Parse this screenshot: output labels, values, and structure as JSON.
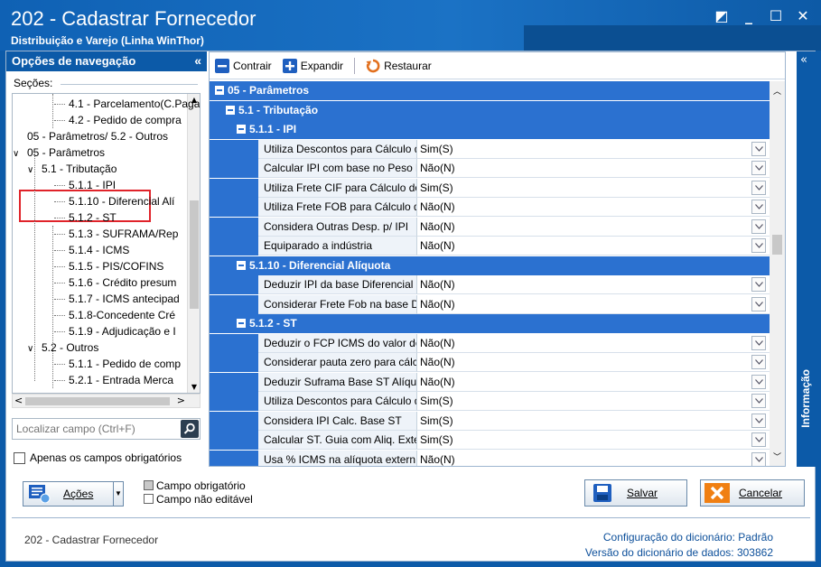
{
  "window": {
    "title": "202 - Cadastrar  Fornecedor",
    "subtitle": "Distribuição e Varejo (Linha WinThor)",
    "controls": [
      "◩",
      "_",
      "☐",
      "✕"
    ]
  },
  "nav": {
    "header": "Opções de navegação",
    "collapse": "«",
    "sections_label": "Seções:",
    "tree": [
      {
        "label": "4.1 - Parcelamento(C.Paga",
        "level": 2
      },
      {
        "label": "4.2 - Pedido de compra",
        "level": 2
      },
      {
        "label": "05 - Parâmetros/ 5.2 - Outros",
        "level": 0
      },
      {
        "label": "05 - Parâmetros",
        "level": 0,
        "expanded": true
      },
      {
        "label": "5.1 - Tributação",
        "level": 1,
        "expanded": true
      },
      {
        "label": "5.1.1 - IPI",
        "level": 2
      },
      {
        "label": "5.1.10 - Diferencial Alí",
        "level": 2
      },
      {
        "label": "5.1.2 - ST",
        "level": 2
      },
      {
        "label": "5.1.3 - SUFRAMA/Rep",
        "level": 2
      },
      {
        "label": "5.1.4 - ICMS",
        "level": 2
      },
      {
        "label": "5.1.5 - PIS/COFINS",
        "level": 2
      },
      {
        "label": "5.1.6 - Crédito presum",
        "level": 2
      },
      {
        "label": "5.1.7 - ICMS antecipad",
        "level": 2
      },
      {
        "label": "5.1.8-Concedente Cré",
        "level": 2
      },
      {
        "label": "5.1.9 - Adjudicação e I",
        "level": 2
      },
      {
        "label": "5.2 - Outros",
        "level": 1,
        "expanded": true
      },
      {
        "label": "5.1.1 - Pedido de comp",
        "level": 2
      },
      {
        "label": "5.2.1 - Entrada Merca",
        "level": 2
      }
    ],
    "search_placeholder": "Localizar campo (Ctrl+F)",
    "required_only_label": "Apenas os campos obrigatórios"
  },
  "toolbar": {
    "collapse_label": "Contrair",
    "expand_label": "Expandir",
    "restore_label": "Restaurar"
  },
  "grid": {
    "categories": [
      {
        "title": "05 - Parâmetros",
        "level": 0
      },
      {
        "title": "5.1 - Tributação",
        "level": 1
      },
      {
        "title": "5.1.1 - IPI",
        "level": 2,
        "rows": [
          {
            "name": "Utiliza Descontos para Cálculo d",
            "value": "Sim(S)"
          },
          {
            "name": "Calcular IPI com base no Peso lí",
            "value": "Não(N)"
          },
          {
            "name": "Utiliza Frete CIF para Cálculo do",
            "value": "Sim(S)"
          },
          {
            "name": "Utiliza Frete FOB para Cálculo d",
            "value": "Não(N)"
          },
          {
            "name": "Considera Outras Desp. p/ IPI",
            "value": "Não(N)"
          },
          {
            "name": "Equiparado a indústria",
            "value": "Não(N)"
          }
        ]
      },
      {
        "title": "5.1.10 - Diferencial Alíquota",
        "level": 2,
        "rows": [
          {
            "name": "Deduzir IPI da base Diferencial",
            "value": "Não(N)"
          },
          {
            "name": "Considerar Frete Fob na base D",
            "value": "Não(N)"
          }
        ]
      },
      {
        "title": "5.1.2 - ST",
        "level": 2,
        "rows": [
          {
            "name": "Deduzir o FCP ICMS do valor do",
            "value": "Não(N)"
          },
          {
            "name": "Considerar pauta zero para cálc",
            "value": "Não(N)"
          },
          {
            "name": "Deduzir Suframa Base ST Alíquo",
            "value": "Não(N)"
          },
          {
            "name": "Utiliza Descontos para Cálculo d",
            "value": "Sim(S)"
          },
          {
            "name": "Considera IPI Calc. Base ST",
            "value": "Sim(S)"
          },
          {
            "name": "Calcular ST. Guia com Aliq. Exte",
            "value": "Sim(S)"
          },
          {
            "name": "Usa % ICMS na alíquota extern",
            "value": "Não(N)"
          }
        ]
      }
    ]
  },
  "side_panel": {
    "label": "Informação",
    "collapse": "«"
  },
  "bottom": {
    "actions_label": "Ações",
    "legend_required": "Campo obrigatório",
    "legend_readonly": "Campo não editável",
    "save_label": "Salvar",
    "cancel_label": "Cancelar"
  },
  "footer": {
    "left": "202 - Cadastrar  Fornecedor",
    "dict_config_label": "Configuração do dicionário:",
    "dict_config_value": "Padrão",
    "dict_version_label": "Versão do dicionário de dados:",
    "dict_version_value": "303862"
  },
  "colors": {
    "brand_blue": "#0c5aa8",
    "category_blue": "#2b71d0",
    "highlight_red": "#e0232a"
  }
}
